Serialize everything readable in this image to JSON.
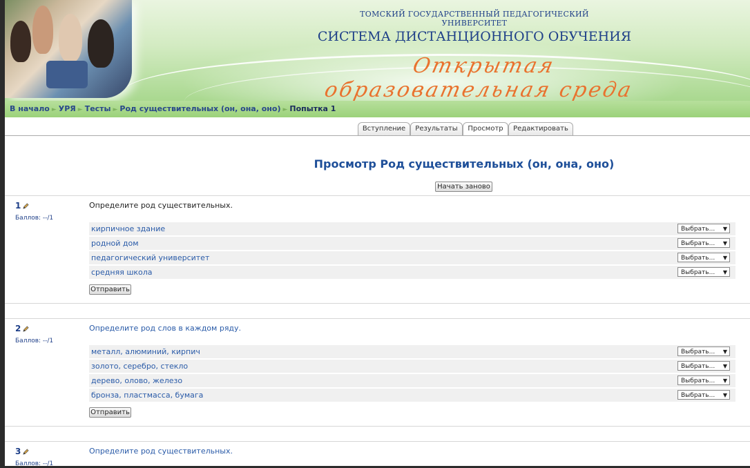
{
  "header": {
    "university": "ТОМСКИЙ ГОСУДАРСТВЕННЫЙ ПЕДАГОГИЧЕСКИЙ УНИВЕРСИТЕТ",
    "system": "СИСТЕМА ДИСТАНЦИОННОГО ОБУЧЕНИЯ",
    "slogan": "Открытая образовательная среда"
  },
  "breadcrumb": {
    "items": [
      "В начало",
      "УРЯ",
      "Тесты",
      "Род существительных (он, она, оно)"
    ],
    "current": "Попытка 1",
    "separator": "►"
  },
  "tabs": [
    {
      "label": "Вступление",
      "active": false
    },
    {
      "label": "Результаты",
      "active": false
    },
    {
      "label": "Просмотр",
      "active": true
    },
    {
      "label": "Редактировать",
      "active": false
    }
  ],
  "page": {
    "title": "Просмотр Род существительных (он, она, оно)",
    "restart_label": "Начать заново"
  },
  "questions": [
    {
      "number": "1",
      "grade": "Баллов: --/1",
      "text": "Определите род существительных.",
      "rows": [
        "кирпичное здание",
        "родной дом",
        "педагогический университет",
        "средняя школа"
      ],
      "select_label": "Выбрать...",
      "submit_label": "Отправить"
    },
    {
      "number": "2",
      "grade": "Баллов: --/1",
      "text": "Определите род слов в каждом ряду.",
      "rows": [
        "металл, алюминий, кирпич",
        "золото, серебро, стекло",
        "дерево, олово, железо",
        "бронза, пластмасса, бумага"
      ],
      "select_label": "Выбрать...",
      "submit_label": "Отправить"
    },
    {
      "number": "3",
      "grade": "Баллов: --/1",
      "text": "Определите род существительных."
    }
  ],
  "colors": {
    "header_green": "#a9d88f",
    "breadcrumb_green": "#9bd27a",
    "link_blue": "#2a5ba8",
    "title_blue": "#1e4f99",
    "slogan_orange": "#e9722e"
  }
}
